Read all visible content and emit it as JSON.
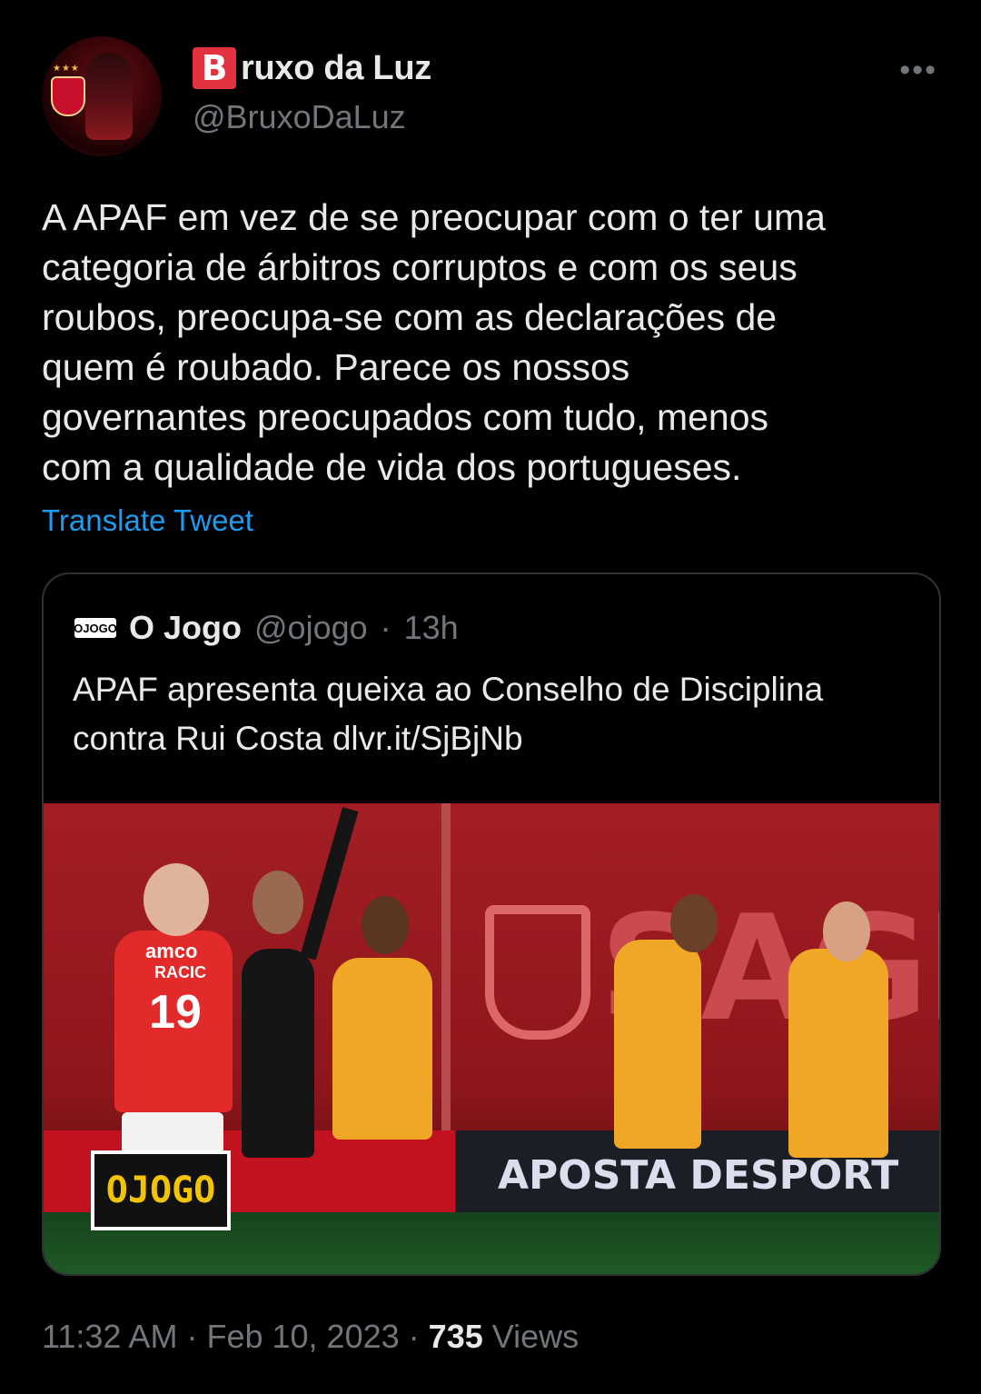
{
  "author": {
    "badge_letter": "B",
    "display_name_rest": "ruxo da Luz",
    "handle": "@BruxoDaLuz",
    "avatar_icon": "benfica-crest-avatar"
  },
  "more_icon": "•••",
  "tweet": {
    "text": "A APAF em vez de se preocupar com o ter uma\ncategoria de árbitros corruptos e com os seus\nroubos, preocupa-se com as declarações de\nquem é roubado. Parece os nossos\ngovernantes preocupados com tudo, menos\ncom a qualidade de vida dos portugueses.",
    "translate_label": "Translate Tweet"
  },
  "quote": {
    "logo_text": "OJOGO",
    "name": "O Jogo",
    "handle": "@ojogo",
    "separator": "·",
    "time": "13h",
    "text": "APAF apresenta queixa ao Conselho de Disciplina\ncontra Rui Costa dlvr.it/SjBjNb",
    "image": {
      "watermark": "OJOGO",
      "wall_text": "SAGRE",
      "board_text": "APOSTA DESPORT",
      "player_number": "19",
      "player_name": "RACIC",
      "sponsor": "amco"
    }
  },
  "meta": {
    "time": "11:32 AM",
    "sep1": "·",
    "date": "Feb 10, 2023",
    "sep2": "·",
    "views_count": "735",
    "views_label": "Views"
  },
  "colors": {
    "background": "#000000",
    "link": "#1d9bf0",
    "muted": "#71767b",
    "badge": "#e2313f"
  }
}
